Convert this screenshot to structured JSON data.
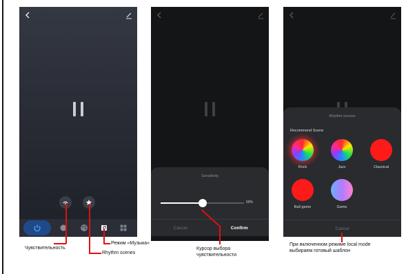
{
  "screen1": {
    "controls": [
      "sensitivity-icon",
      "star-icon"
    ],
    "nav_icons": [
      "power-icon",
      "dot-icon",
      "palette-icon",
      "music-icon",
      "grid-icon"
    ],
    "power_color": "#1f4a8a"
  },
  "screen2": {
    "sheet_title": "Sensitivity",
    "slider_value": "50%",
    "slider_fraction": 0.5,
    "cancel_label": "Cancel",
    "confirm_label": "Confirm"
  },
  "screen3": {
    "sheet_title": "Rhythm scenes",
    "section_label": "Recommend Scene",
    "scenes": [
      {
        "label": "Rock",
        "style": "rainbow",
        "selected": true
      },
      {
        "label": "Jazz",
        "style": "rainbow",
        "selected": false
      },
      {
        "label": "Classical",
        "style": "solid-red",
        "selected": false
      },
      {
        "label": "Ball game",
        "style": "solid-red",
        "selected": false
      },
      {
        "label": "Game",
        "style": "pastel",
        "selected": false
      }
    ],
    "cancel_label": "Cancel"
  },
  "annotations": {
    "sensitivity": "Чувствительность",
    "rhythm_scenes": "Rhythm scenes",
    "music_mode": "Режим «Музыка»",
    "cursor_line1": "Курсор выбора",
    "cursor_line2": "чувствительности",
    "local_line1": "При включенном режиме local mode",
    "local_line2": "выбираем готовый шаблон"
  },
  "colors": {
    "annotation_line": "#e01010",
    "accent_red": "#ff1a1a"
  }
}
